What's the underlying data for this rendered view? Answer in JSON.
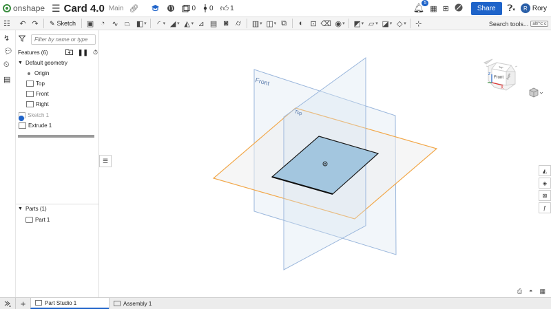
{
  "app": {
    "logo_text": "onshape",
    "document_title": "Card 4.0",
    "branch": "Main"
  },
  "top_counts": {
    "versions": "0",
    "branches": "0",
    "likes": "1"
  },
  "notifications": {
    "count": "5"
  },
  "share_label": "Share",
  "user": {
    "name": "Rory",
    "initial": "R"
  },
  "toolbar": {
    "sketch_label": "Sketch",
    "search_label": "Search tools...",
    "search_shortcut": "alt/⌥ c"
  },
  "filter": {
    "placeholder": "Filter by name or type"
  },
  "features": {
    "header": "Features (6)",
    "default_geometry_label": "Default geometry",
    "items": [
      {
        "label": "Origin"
      },
      {
        "label": "Top"
      },
      {
        "label": "Front"
      },
      {
        "label": "Right"
      },
      {
        "label": "Sketch 1"
      },
      {
        "label": "Extrude 1"
      }
    ]
  },
  "parts": {
    "header": "Parts (1)",
    "items": [
      {
        "label": "Part 1"
      }
    ]
  },
  "viewport": {
    "plane_front_label": "Front",
    "plane_top_label": "Top",
    "view_cube": {
      "top": "Top",
      "front": "Front",
      "right": "Right",
      "x_axis": "X",
      "z_axis": "Z"
    }
  },
  "tabs": [
    {
      "label": "Part Studio 1",
      "active": true
    },
    {
      "label": "Assembly 1",
      "active": false
    }
  ],
  "colors": {
    "accent": "#1e63c9",
    "brand": "#3a8d3f",
    "top_plane": "#f2a84a",
    "front_plane": "#8fb0d8",
    "part_face": "#a3c6df"
  }
}
